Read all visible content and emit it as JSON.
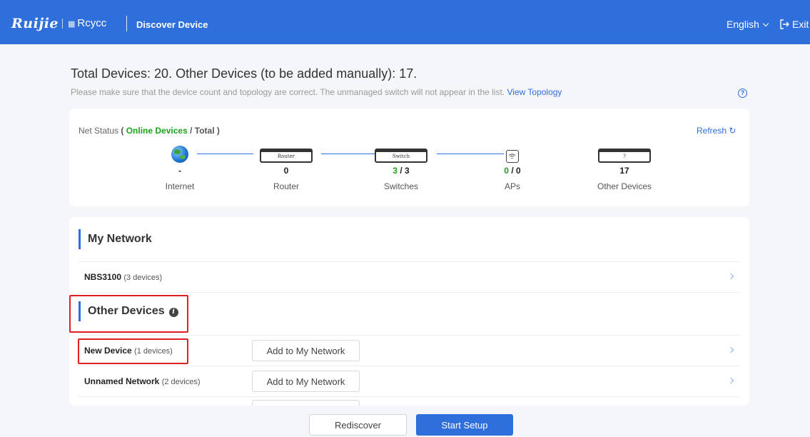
{
  "header": {
    "brand": "Ruijie",
    "sub_brand": "Rcycc",
    "title": "Discover Device",
    "language": "English",
    "exit_label": "Exit"
  },
  "summary": {
    "text": "Total Devices: 20. Other Devices (to be added manually): 17.",
    "hint": "Please make sure that the device count and topology are correct. The unmanaged switch will not appear in the list.",
    "topology_link": "View Topology",
    "help_glyph": "?"
  },
  "net_status": {
    "label": "Net Status",
    "paren_open": "(",
    "online": "Online Devices",
    "slash": " / ",
    "total": "Total",
    "paren_close": ")",
    "refresh": "Refresh ↻",
    "nodes": {
      "internet": {
        "value": "-",
        "name": "Internet"
      },
      "router": {
        "icon_text": "Router",
        "value": "0",
        "name": "Router"
      },
      "switches": {
        "icon_text": "Switch",
        "online": "3",
        "sep": " / ",
        "total": "3",
        "name": "Switches"
      },
      "aps": {
        "online": "0",
        "sep": " / ",
        "total": "0",
        "name": "APs"
      },
      "other": {
        "icon_text": "?",
        "value": "17",
        "name": "Other Devices"
      }
    }
  },
  "my_network": {
    "title": "My Network",
    "rows": [
      {
        "name": "NBS3100",
        "count": "(3 devices)"
      }
    ]
  },
  "other_devices": {
    "title": "Other Devices",
    "info_glyph": "i",
    "rows": [
      {
        "name": "New Device",
        "count": "(1 devices)",
        "action": "Add to My Network"
      },
      {
        "name": "Unnamed Network",
        "count": "(2 devices)",
        "action": "Add to My Network"
      }
    ]
  },
  "footer": {
    "rediscover": "Rediscover",
    "start_setup": "Start Setup"
  },
  "colors": {
    "primary": "#2f6fdb",
    "online_green": "#1aa51a",
    "highlight_red": "#e02020"
  }
}
